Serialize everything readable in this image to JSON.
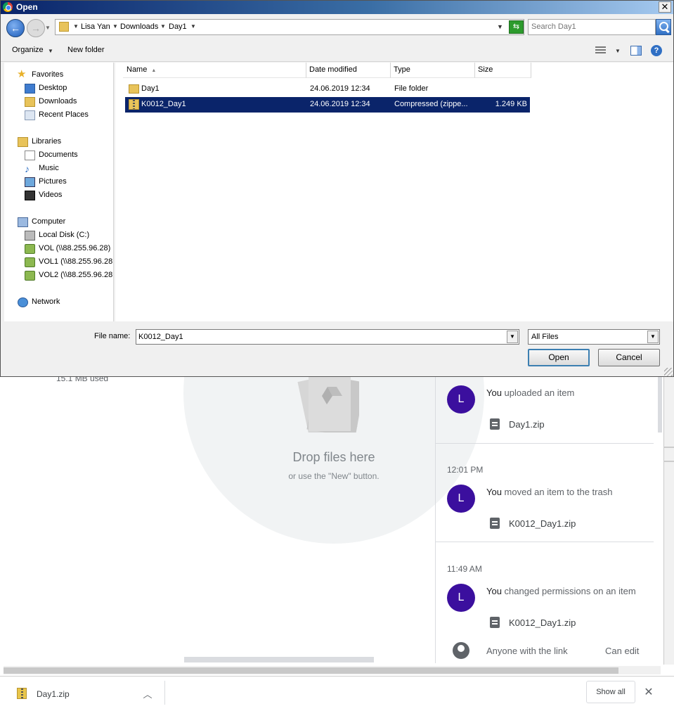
{
  "dialog": {
    "title": "Open",
    "breadcrumb": [
      "Lisa Yan",
      "Downloads",
      "Day1"
    ],
    "search_placeholder": "Search Day1",
    "toolbar": {
      "organize": "Organize",
      "new_folder": "New folder"
    },
    "nav": {
      "favorites": {
        "label": "Favorites",
        "items": [
          "Desktop",
          "Downloads",
          "Recent Places"
        ]
      },
      "libraries": {
        "label": "Libraries",
        "items": [
          "Documents",
          "Music",
          "Pictures",
          "Videos"
        ]
      },
      "computer": {
        "label": "Computer",
        "items": [
          "Local Disk (C:)",
          "VOL (\\\\88.255.96.28)",
          "VOL1 (\\\\88.255.96.28",
          "VOL2 (\\\\88.255.96.28"
        ]
      },
      "network": {
        "label": "Network"
      }
    },
    "columns": [
      "Name",
      "Date modified",
      "Type",
      "Size"
    ],
    "files": [
      {
        "name": "Day1",
        "date": "24.06.2019 12:34",
        "type": "File folder",
        "size": ""
      },
      {
        "name": "K0012_Day1",
        "date": "24.06.2019 12:34",
        "type": "Compressed (zippe...",
        "size": "1.249 KB"
      }
    ],
    "filename_label": "File name:",
    "filename_value": "K0012_Day1",
    "filetype": "All Files",
    "open_label": "Open",
    "cancel_label": "Cancel"
  },
  "drive": {
    "storage_text": "15.1 MB used",
    "drop_title": "Drop files here",
    "drop_sub": "or use the \"New\" button.",
    "activity": [
      {
        "avatar": "L",
        "actor": "You",
        "action": " uploaded an item",
        "file": "Day1.zip"
      },
      {
        "time": "12:01 PM",
        "avatar": "L",
        "actor": "You",
        "action": " moved an item to the trash",
        "file": "K0012_Day1.zip"
      },
      {
        "time": "11:49 AM",
        "avatar": "L",
        "actor": "You",
        "action": " changed permissions on an item",
        "file": "K0012_Day1.zip"
      }
    ],
    "share_text": "Anyone with the link",
    "share_perm": "Can edit"
  },
  "downloads": {
    "file": "Day1.zip",
    "show_all": "Show all"
  }
}
